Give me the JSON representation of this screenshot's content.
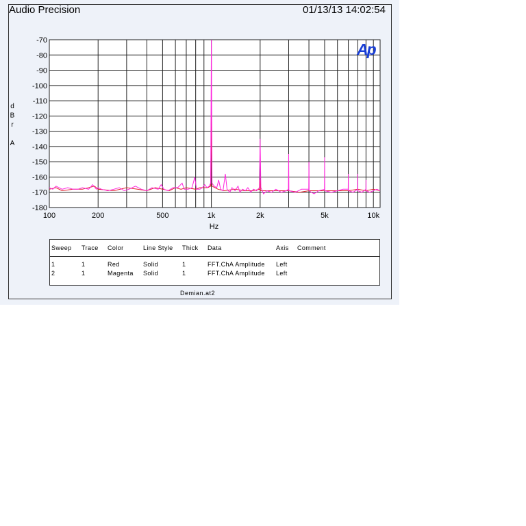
{
  "header": {
    "app_title": "Audio Precision",
    "timestamp": "01/13/13 14:02:54"
  },
  "logo_text": "Ap",
  "filename": "Demian.at2",
  "legend": {
    "columns": [
      "Sweep",
      "Trace",
      "Color",
      "Line Style",
      "Thick",
      "Data",
      "Axis",
      "Comment"
    ],
    "rows": [
      [
        "1",
        "1",
        "Red",
        "Solid",
        "1",
        "FFT.ChA Amplitude",
        "Left",
        ""
      ],
      [
        "2",
        "1",
        "Magenta",
        "Solid",
        "1",
        "FFT.ChA Amplitude",
        "Left",
        ""
      ]
    ]
  },
  "colors": {
    "panel_bg": "#eef2f9",
    "red": "#e0202a",
    "magenta": "#ff22dd",
    "logo": "#1a3fd6"
  },
  "chart_data": {
    "type": "line",
    "title": "",
    "xlabel": "Hz",
    "ylabel": "dBr A",
    "xscale": "log",
    "xlim": [
      100,
      11000
    ],
    "ylim": [
      -180,
      -70
    ],
    "grid": true,
    "legend_position": "below",
    "x_ticks": [
      {
        "v": 100,
        "label": "100"
      },
      {
        "v": 200,
        "label": "200"
      },
      {
        "v": 500,
        "label": "500"
      },
      {
        "v": 1000,
        "label": "1k"
      },
      {
        "v": 2000,
        "label": "2k"
      },
      {
        "v": 5000,
        "label": "5k"
      },
      {
        "v": 10000,
        "label": "10k"
      }
    ],
    "x_grid": [
      100,
      200,
      300,
      400,
      500,
      600,
      700,
      800,
      900,
      1000,
      2000,
      3000,
      4000,
      5000,
      6000,
      7000,
      8000,
      9000,
      10000
    ],
    "y_ticks": [
      -70,
      -80,
      -90,
      -100,
      -110,
      -120,
      -130,
      -140,
      -150,
      -160,
      -170,
      -180
    ],
    "series": [
      {
        "name": "Red",
        "color": "#e0202a",
        "points": [
          [
            100,
            -168
          ],
          [
            110,
            -167
          ],
          [
            120,
            -169
          ],
          [
            140,
            -168
          ],
          [
            160,
            -168
          ],
          [
            190,
            -166
          ],
          [
            200,
            -168
          ],
          [
            250,
            -169
          ],
          [
            300,
            -167
          ],
          [
            350,
            -168
          ],
          [
            400,
            -169
          ],
          [
            450,
            -167
          ],
          [
            500,
            -168
          ],
          [
            550,
            -169
          ],
          [
            600,
            -167
          ],
          [
            650,
            -168
          ],
          [
            700,
            -167
          ],
          [
            800,
            -168
          ],
          [
            850,
            -167
          ],
          [
            950,
            -167
          ],
          [
            990,
            -166
          ],
          [
            1000,
            -118
          ],
          [
            1010,
            -166
          ],
          [
            1100,
            -168
          ],
          [
            1200,
            -169
          ],
          [
            1400,
            -168
          ],
          [
            1600,
            -169
          ],
          [
            1800,
            -169
          ],
          [
            1990,
            -168
          ],
          [
            2000,
            -162
          ],
          [
            2010,
            -169
          ],
          [
            2500,
            -169
          ],
          [
            3000,
            -169
          ],
          [
            3500,
            -170
          ],
          [
            4000,
            -169
          ],
          [
            4500,
            -169
          ],
          [
            5000,
            -169
          ],
          [
            6000,
            -169
          ],
          [
            7000,
            -169
          ],
          [
            8000,
            -168
          ],
          [
            9000,
            -169
          ],
          [
            10000,
            -168
          ],
          [
            11000,
            -169
          ]
        ]
      },
      {
        "name": "Magenta",
        "color": "#ff22dd",
        "points": [
          [
            100,
            -167
          ],
          [
            105,
            -168
          ],
          [
            110,
            -166
          ],
          [
            120,
            -168
          ],
          [
            130,
            -167
          ],
          [
            140,
            -168
          ],
          [
            150,
            -168
          ],
          [
            160,
            -167
          ],
          [
            175,
            -168
          ],
          [
            185,
            -165
          ],
          [
            195,
            -168
          ],
          [
            200,
            -167
          ],
          [
            210,
            -168
          ],
          [
            230,
            -169
          ],
          [
            250,
            -168
          ],
          [
            270,
            -167
          ],
          [
            290,
            -169
          ],
          [
            310,
            -168
          ],
          [
            340,
            -166
          ],
          [
            370,
            -168
          ],
          [
            400,
            -169
          ],
          [
            430,
            -167
          ],
          [
            470,
            -168
          ],
          [
            490,
            -165
          ],
          [
            510,
            -168
          ],
          [
            540,
            -169
          ],
          [
            580,
            -167
          ],
          [
            620,
            -167
          ],
          [
            660,
            -164
          ],
          [
            680,
            -168
          ],
          [
            720,
            -168
          ],
          [
            760,
            -167
          ],
          [
            790,
            -160
          ],
          [
            810,
            -168
          ],
          [
            850,
            -168
          ],
          [
            880,
            -167
          ],
          [
            910,
            -165
          ],
          [
            940,
            -167
          ],
          [
            970,
            -166
          ],
          [
            990,
            -164
          ],
          [
            1000,
            -70
          ],
          [
            1010,
            -164
          ],
          [
            1040,
            -166
          ],
          [
            1080,
            -167
          ],
          [
            1110,
            -162
          ],
          [
            1140,
            -168
          ],
          [
            1180,
            -169
          ],
          [
            1220,
            -158
          ],
          [
            1250,
            -168
          ],
          [
            1300,
            -170
          ],
          [
            1340,
            -167
          ],
          [
            1400,
            -169
          ],
          [
            1460,
            -166
          ],
          [
            1500,
            -170
          ],
          [
            1560,
            -168
          ],
          [
            1620,
            -169
          ],
          [
            1680,
            -167
          ],
          [
            1750,
            -170
          ],
          [
            1820,
            -168
          ],
          [
            1900,
            -169
          ],
          [
            1980,
            -167
          ],
          [
            2000,
            -135
          ],
          [
            2020,
            -167
          ],
          [
            2100,
            -171
          ],
          [
            2200,
            -169
          ],
          [
            2350,
            -170
          ],
          [
            2500,
            -168
          ],
          [
            2700,
            -170
          ],
          [
            2900,
            -169
          ],
          [
            2990,
            -168
          ],
          [
            3000,
            -145
          ],
          [
            3010,
            -169
          ],
          [
            3300,
            -170
          ],
          [
            3600,
            -168
          ],
          [
            3990,
            -168
          ],
          [
            4000,
            -150
          ],
          [
            4010,
            -169
          ],
          [
            4300,
            -171
          ],
          [
            4600,
            -169
          ],
          [
            4990,
            -168
          ],
          [
            5000,
            -147
          ],
          [
            5010,
            -169
          ],
          [
            5500,
            -170
          ],
          [
            6000,
            -169
          ],
          [
            6500,
            -168
          ],
          [
            6990,
            -168
          ],
          [
            7000,
            -158
          ],
          [
            7010,
            -169
          ],
          [
            7500,
            -170
          ],
          [
            7990,
            -168
          ],
          [
            8000,
            -158
          ],
          [
            8010,
            -169
          ],
          [
            8500,
            -170
          ],
          [
            8990,
            -168
          ],
          [
            9000,
            -162
          ],
          [
            9010,
            -169
          ],
          [
            9500,
            -170
          ],
          [
            10000,
            -169
          ],
          [
            10500,
            -168
          ],
          [
            11000,
            -169
          ]
        ]
      }
    ]
  }
}
